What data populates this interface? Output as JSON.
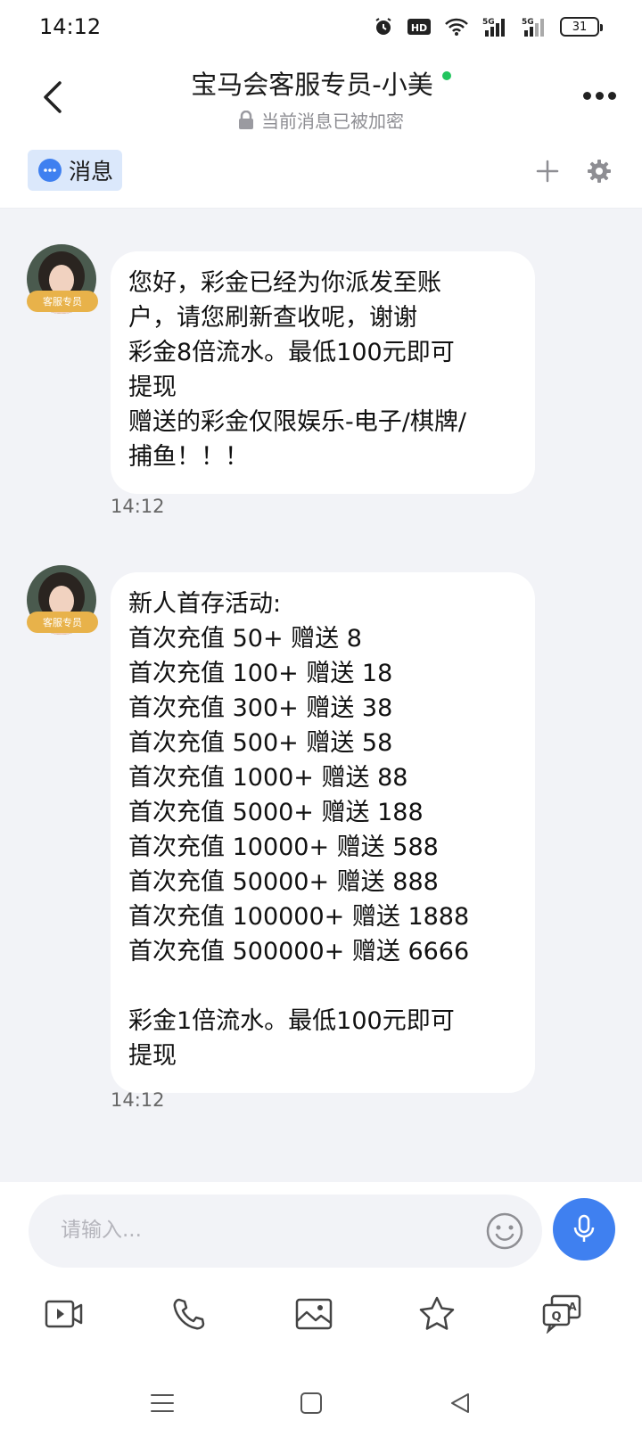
{
  "status_bar": {
    "time": "14:12",
    "battery": "31",
    "icons": [
      "alarm-icon",
      "hd-icon",
      "wifi-icon",
      "signal-5g-icon",
      "signal-5g-icon",
      "battery-icon"
    ]
  },
  "header": {
    "title": "宝马会客服专员-小美",
    "subtitle": "当前消息已被加密",
    "online_color": "#22c55e"
  },
  "tabbar": {
    "message_tab": "消息",
    "accent": "#3f80f0"
  },
  "messages": [
    {
      "sender_badge": "客服专员",
      "text": "您好，彩金已经为你派发至账\n户，请您刷新查收呢，谢谢\n彩金8倍流水。最低100元即可\n提现\n赠送的彩金仅限娱乐-电子/棋牌/\n捕鱼！！！",
      "time": "14:12"
    },
    {
      "sender_badge": "客服专员",
      "text": "新人首存活动:\n首次充值 50+ 赠送 8\n首次充值 100+ 赠送 18\n首次充值 300+ 赠送 38\n首次充值 500+ 赠送 58\n首次充值 1000+ 赠送 88\n首次充值 5000+ 赠送 188\n首次充值 10000+ 赠送 588\n首次充值 50000+ 赠送 888\n首次充值 100000+ 赠送 1888\n首次充值 500000+ 赠送 6666\n\n彩金1倍流水。最低100元即可\n提现",
      "time": "14:12"
    }
  ],
  "input": {
    "placeholder": "请输入..."
  },
  "toolbar": {
    "tools": [
      "video-icon",
      "phone-icon",
      "image-icon",
      "star-icon",
      "quick-reply-icon"
    ]
  },
  "nav": {
    "buttons": [
      "menu-icon",
      "home-icon",
      "back-icon"
    ]
  }
}
